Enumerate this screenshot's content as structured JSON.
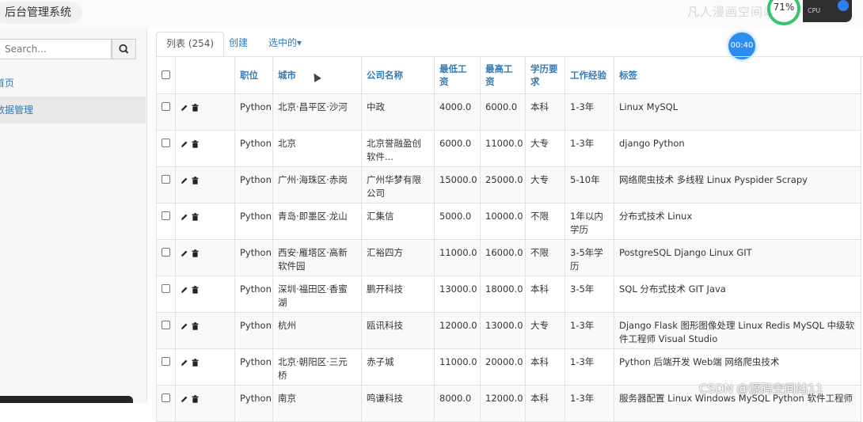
{
  "app": {
    "title": "后台管理系统"
  },
  "overlay": {
    "top_watermark": "凡人漫画空间站",
    "cpu_percent": "71%",
    "cpu_label": "CPU",
    "timer": "00:40",
    "bottom_watermark": "CSDN @源码空间站11"
  },
  "sidebar": {
    "search_placeholder": "Search...",
    "items": [
      {
        "label": "首页",
        "active": false
      },
      {
        "label": "数据管理",
        "active": true
      }
    ]
  },
  "tabs": [
    {
      "label": "列表 (254)",
      "active": true
    },
    {
      "label": "创建",
      "active": false
    },
    {
      "label": "选中的▾",
      "active": false
    }
  ],
  "table": {
    "columns": [
      "职位",
      "城市",
      "公司名称",
      "最低工资",
      "最高工资",
      "学历要求",
      "工作经验",
      "标签"
    ],
    "rows": [
      [
        "Python",
        "北京·昌平区·沙河",
        "中政",
        "4000.0",
        "6000.0",
        "本科",
        "1-3年",
        "Linux MySQL"
      ],
      [
        "Python",
        "北京",
        "北京誉融盈创软件...",
        "6000.0",
        "11000.0",
        "大专",
        "1-3年",
        "django Python"
      ],
      [
        "Python",
        "广州·海珠区·赤岗",
        "广州华梦有限公司",
        "15000.0",
        "25000.0",
        "大专",
        "5-10年",
        "网络爬虫技术 多线程 Linux Pyspider Scrapy"
      ],
      [
        "Python",
        "青岛·即墨区·龙山",
        "汇集信",
        "5000.0",
        "10000.0",
        "不限",
        "1年以内学历",
        "分布式技术 Linux"
      ],
      [
        "Python",
        "西安·雁塔区·高新软件园",
        "汇裕四方",
        "11000.0",
        "16000.0",
        "不限",
        "3-5年学历",
        "PostgreSQL Django Linux GIT"
      ],
      [
        "Python",
        "深圳·福田区·香蜜湖",
        "鹏开科技",
        "13000.0",
        "18000.0",
        "本科",
        "3-5年",
        "SQL 分布式技术 GIT Java"
      ],
      [
        "Python",
        "杭州",
        "瓯讯科技",
        "12000.0",
        "13000.0",
        "大专",
        "1-3年",
        "Django Flask 图形图像处理 Linux Redis MySQL 中级软件工程师 Visual Studio"
      ],
      [
        "Python",
        "北京·朝阳区·三元桥",
        "赤子城",
        "11000.0",
        "20000.0",
        "本科",
        "1-3年",
        "Python 后端开发 Web端 网络爬虫技术"
      ],
      [
        "Python",
        "南京",
        "鸣谦科技",
        "8000.0",
        "12000.0",
        "本科",
        "1-3年",
        "服务器配置 Linux Windows MySQL Python 软件工程师"
      ]
    ]
  }
}
